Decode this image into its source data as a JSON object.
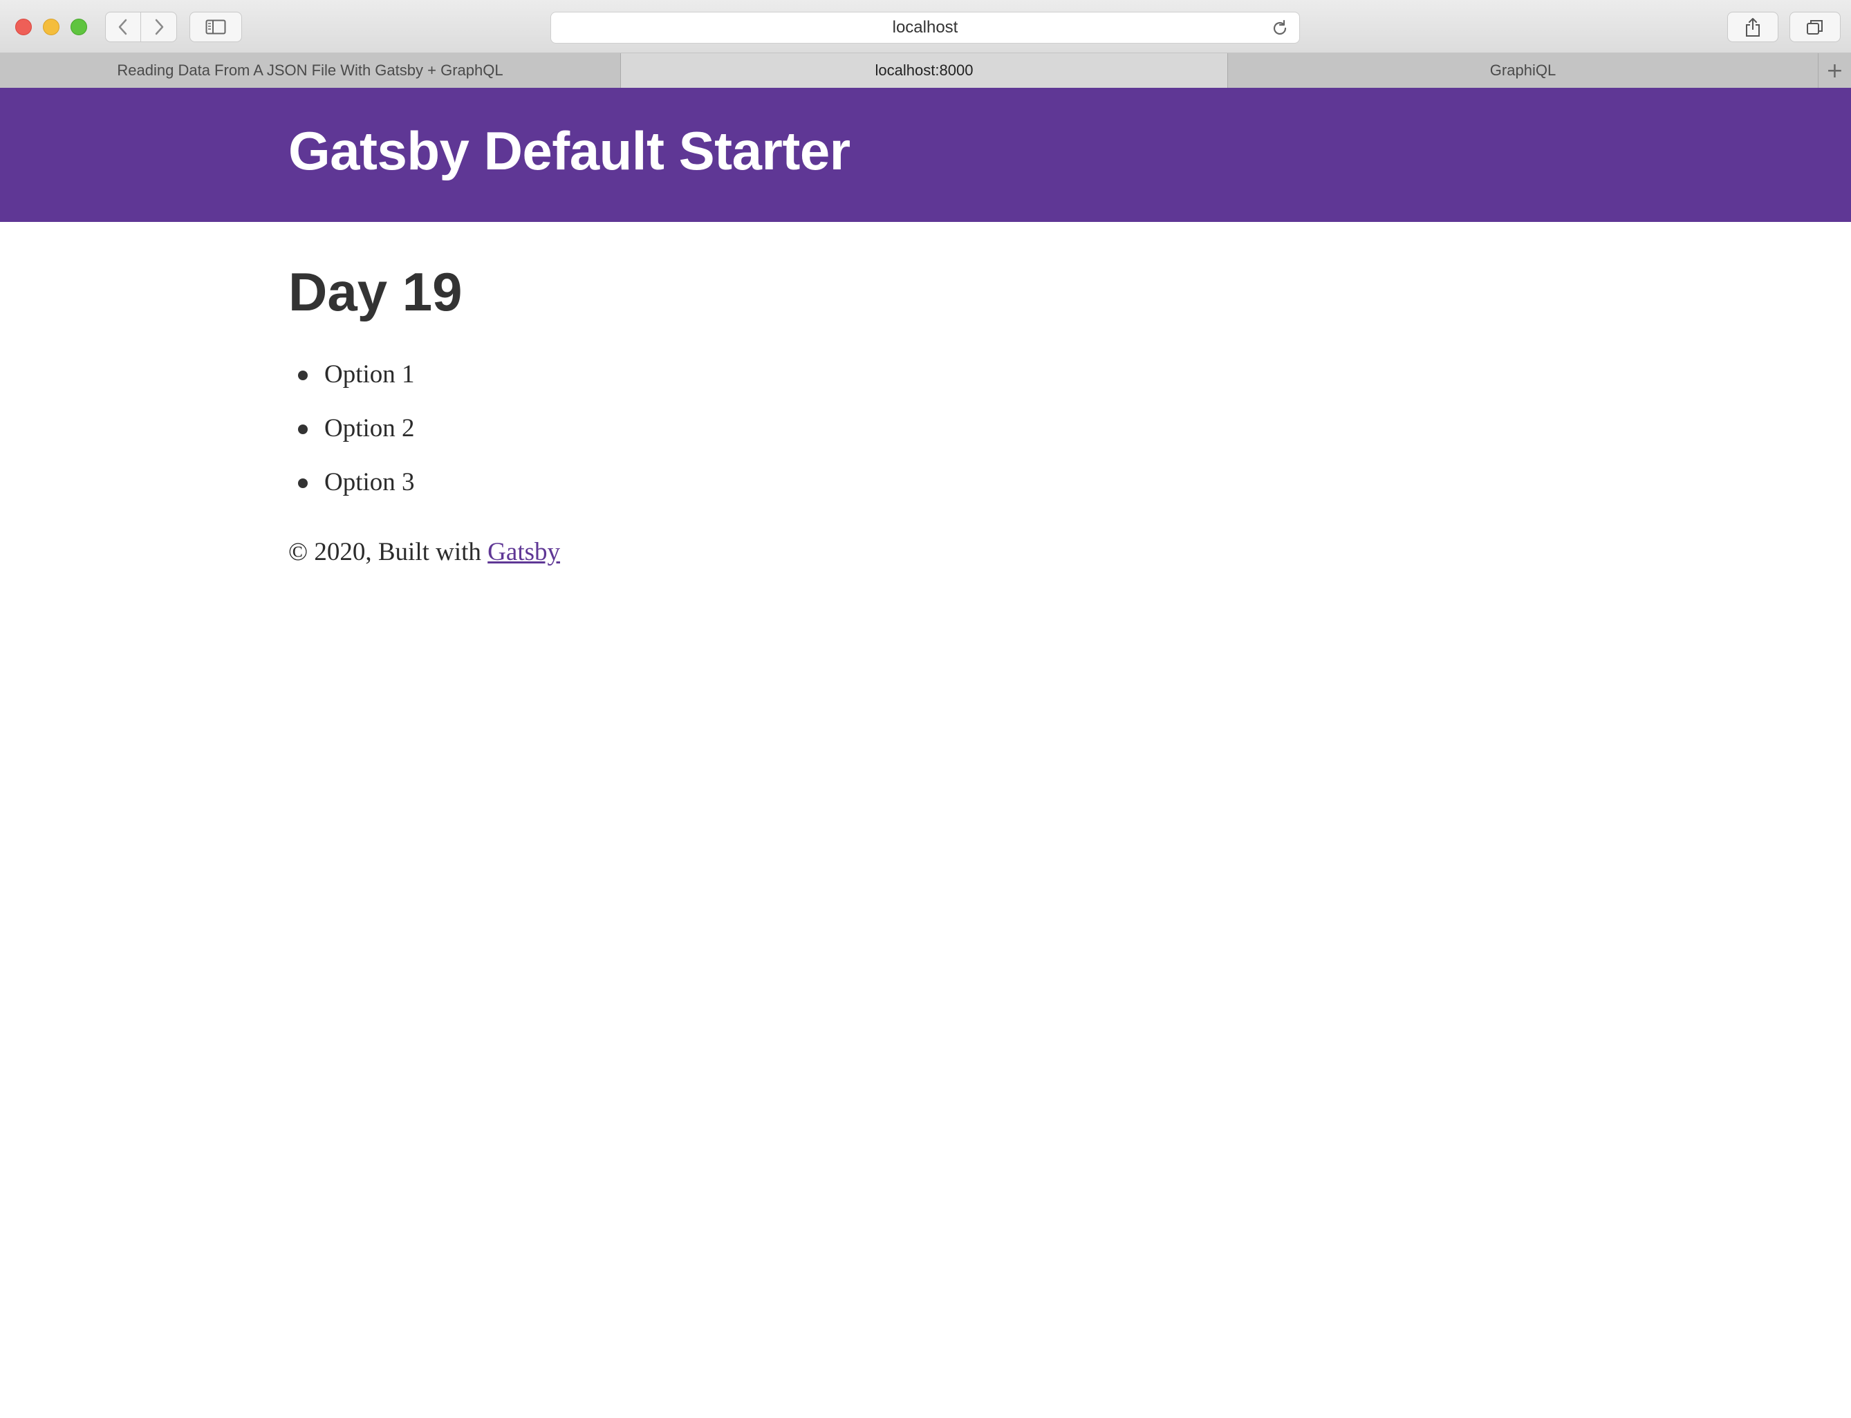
{
  "browser": {
    "address": "localhost",
    "tabs": [
      {
        "label": "Reading Data From A JSON File With Gatsby + GraphQL",
        "active": false
      },
      {
        "label": "localhost:8000",
        "active": true
      },
      {
        "label": "GraphiQL",
        "active": false
      }
    ],
    "new_tab_glyph": "+"
  },
  "site": {
    "title": "Gatsby Default Starter",
    "header_color": "#5f3795"
  },
  "page": {
    "heading": "Day 19",
    "options": [
      "Option 1",
      "Option 2",
      "Option 3"
    ]
  },
  "footer": {
    "prefix": "© 2020, Built with",
    "link_label": "Gatsby",
    "link_color": "#5f3795"
  },
  "icons": {
    "back": "chevron-left-icon",
    "forward": "chevron-right-icon",
    "sidebar": "sidebar-icon",
    "reload": "reload-icon",
    "share": "share-icon",
    "tabs": "tabs-overview-icon"
  }
}
